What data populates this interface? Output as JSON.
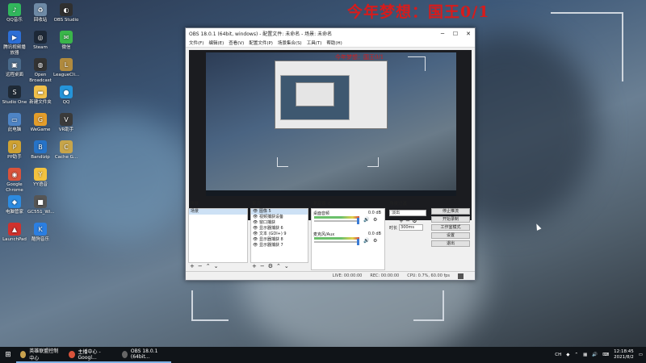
{
  "overlay_text": "今年梦想：国王0/1",
  "desktop_icons": [
    {
      "label": "QQ音乐",
      "color": "#31b75c",
      "glyph": "♪"
    },
    {
      "label": "腾讯视频播放器",
      "color": "#2d6fd6",
      "glyph": "▶"
    },
    {
      "label": "远程桌面",
      "color": "#4a6a8a",
      "glyph": "▣"
    },
    {
      "label": "Studio One",
      "color": "#1f2a36",
      "glyph": "S"
    },
    {
      "label": "此电脑",
      "color": "#4e84c5",
      "glyph": "▭"
    },
    {
      "label": "PP助手",
      "color": "#cfa233",
      "glyph": "P"
    },
    {
      "label": "Google Chrome",
      "color": "#d9533b",
      "glyph": "◉"
    },
    {
      "label": "电脑管家",
      "color": "#2d8be0",
      "glyph": "◆"
    },
    {
      "label": "LaunchPad",
      "color": "#d0312d",
      "glyph": "▲"
    },
    {
      "label": "回收站",
      "color": "#6e8aa6",
      "glyph": "♻"
    },
    {
      "label": "Steam",
      "color": "#1d2837",
      "glyph": "◎"
    },
    {
      "label": "Open Broadcast",
      "color": "#333",
      "glyph": "◍"
    },
    {
      "label": "新建文件夹",
      "color": "#f0c04a",
      "glyph": "▬"
    },
    {
      "label": "WeGame",
      "color": "#e49d2a",
      "glyph": "G"
    },
    {
      "label": "Bandizip",
      "color": "#2673c7",
      "glyph": "B"
    },
    {
      "label": "YY语音",
      "color": "#f3c23f",
      "glyph": "Y"
    },
    {
      "label": "GC551_Wi...",
      "color": "#555",
      "glyph": "■"
    },
    {
      "label": "酷狗音乐",
      "color": "#2b7fe2",
      "glyph": "K"
    },
    {
      "label": "OBS Studio",
      "color": "#303030",
      "glyph": "◐"
    },
    {
      "label": "微信",
      "color": "#3ab54a",
      "glyph": "✉"
    },
    {
      "label": "LeagueCli...",
      "color": "#b08a3e",
      "glyph": "L"
    },
    {
      "label": "QQ",
      "color": "#2594d9",
      "glyph": "●"
    },
    {
      "label": "VR助手",
      "color": "#3b3b3b",
      "glyph": "V"
    },
    {
      "label": "Cache G...",
      "color": "#c7a54a",
      "glyph": "C"
    }
  ],
  "obs": {
    "title": "OBS 18.0.1 (64bit, windows) - 配置文件: 未命名 - 场景: 未命名",
    "menu": [
      "文件(F)",
      "编辑(E)",
      "查看(V)",
      "配置文件(P)",
      "场景集合(S)",
      "工具(T)",
      "帮助(H)"
    ],
    "preview_overlay": "今年梦想：国王0/1",
    "panels": {
      "scenes_title": "场景",
      "scenes": [
        "场景"
      ],
      "sources_title": "来源",
      "sources": [
        "图像 5",
        "视频捕获设备",
        "窗口捕获",
        "显示器捕获 6",
        "文本 (GDI+) 9",
        "显示器捕获 8",
        "显示器捕获 7"
      ],
      "mixer_title": "混音器",
      "mixer": [
        {
          "name": "桌面音频",
          "db": "0.0 dB"
        },
        {
          "name": "麦克风/Aux",
          "db": "0.0 dB"
        }
      ],
      "transitions_title": "场景过渡",
      "transition_select": "淡出",
      "duration_label": "时长",
      "duration_value": "300ms",
      "controls": [
        "停止推流",
        "开始录制",
        "工作室模式",
        "设置",
        "退出"
      ]
    },
    "status": {
      "live": "LIVE: 00:00:00",
      "rec": "REC: 00:00:00",
      "cpu": "CPU: 0.7%, 60.00 fps"
    }
  },
  "taskbar": {
    "tasks": [
      {
        "label": "英雄联盟控制中心",
        "color": "#c9a24e"
      },
      {
        "label": "主播中心 - Googl...",
        "color": "#d9533b"
      },
      {
        "label": "OBS 18.0.1 (64bit...",
        "color": "#444"
      }
    ],
    "tray_text": "CH",
    "time": "12:18:45",
    "date": "2021/8/2"
  }
}
